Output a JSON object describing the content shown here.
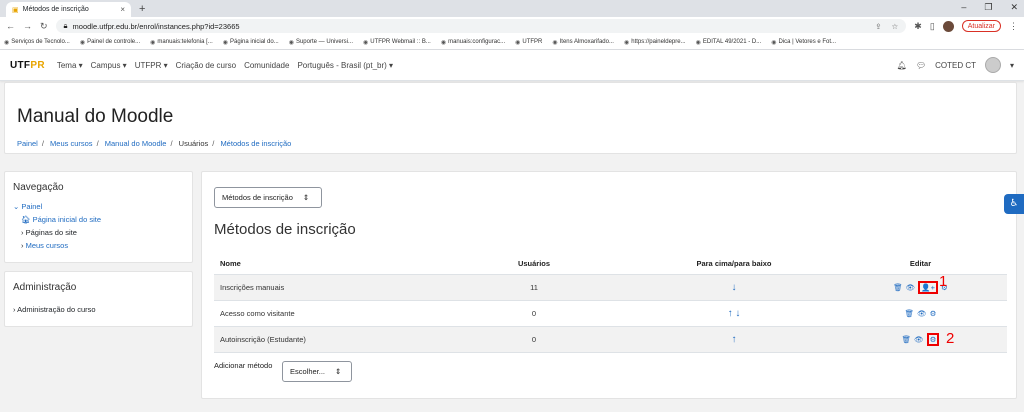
{
  "browser": {
    "tab_title": "Métodos de inscrição",
    "url": "moodle.utfpr.edu.br/enrol/instances.php?id=23665",
    "update_label": "Atualizar",
    "bookmarks": [
      "Serviços de Tecnolo...",
      "Painel de controle...",
      "manuais:telefonia [...",
      "Página inicial do...",
      "Suporte — Universi...",
      "UTFPR Webmail :: B...",
      "manuais:configurac...",
      "UTFPR",
      "Itens Almoxarifado...",
      "https://paineldepre...",
      "EDITAL 49/2021 - D...",
      "Dica | Vetores e Fot..."
    ]
  },
  "nav": {
    "logo_a": "UTF",
    "logo_b": "PR",
    "links": [
      "Tema ▾",
      "Campus ▾",
      "UTFPR ▾",
      "Criação de curso",
      "Comunidade",
      "Português - Brasil (pt_br) ▾"
    ],
    "user": "COTED CT"
  },
  "header": {
    "title": "Manual do Moodle",
    "crumbs": [
      "Painel",
      "Meus cursos",
      "Manual do Moodle",
      "Usuários",
      "Métodos de inscrição"
    ]
  },
  "navigation": {
    "title": "Navegação",
    "painel": "Painel",
    "home": "Página inicial do site",
    "pages": "Páginas do site",
    "courses": "Meus cursos"
  },
  "admin": {
    "title": "Administração",
    "course_admin": "Administração do curso"
  },
  "main": {
    "select_label": "Métodos de inscrição",
    "heading": "Métodos de inscrição",
    "columns": [
      "Nome",
      "Usuários",
      "Para cima/para baixo",
      "Editar"
    ],
    "rows": [
      {
        "name": "Inscrições manuais",
        "users": "11",
        "move": "↓"
      },
      {
        "name": "Acesso como visitante",
        "users": "0",
        "move": "↑ ↓"
      },
      {
        "name": "Autoinscrição (Estudante)",
        "users": "0",
        "move": "↑"
      }
    ],
    "add_method_label": "Adicionar método",
    "add_select": "Escolher...",
    "marker1": "1",
    "marker2": "2"
  }
}
